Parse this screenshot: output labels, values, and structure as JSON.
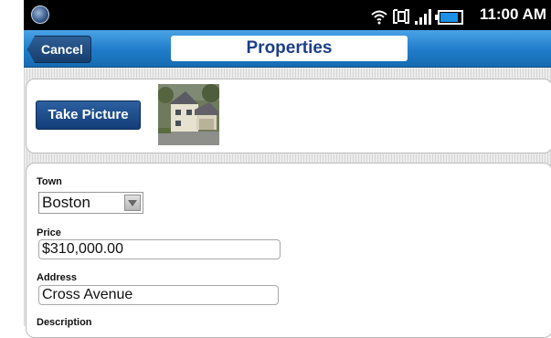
{
  "status_bar": {
    "time": "11:00 AM",
    "icons": [
      "app-icon",
      "wifi-icon",
      "sync-icon",
      "signal-icon",
      "battery-icon"
    ],
    "battery_level": 0.85
  },
  "title_bar": {
    "cancel_label": "Cancel",
    "title": "Properties"
  },
  "photo_panel": {
    "take_picture_label": "Take Picture"
  },
  "form": {
    "town": {
      "label": "Town",
      "value": "Boston"
    },
    "price": {
      "label": "Price",
      "value": "$310,000.00"
    },
    "address": {
      "label": "Address",
      "value": "Cross Avenue"
    },
    "description": {
      "label": "Description"
    }
  },
  "colors": {
    "title_bar": "#1f7cc9",
    "title_text": "#1c3f88",
    "button": "#1e4f8c"
  }
}
